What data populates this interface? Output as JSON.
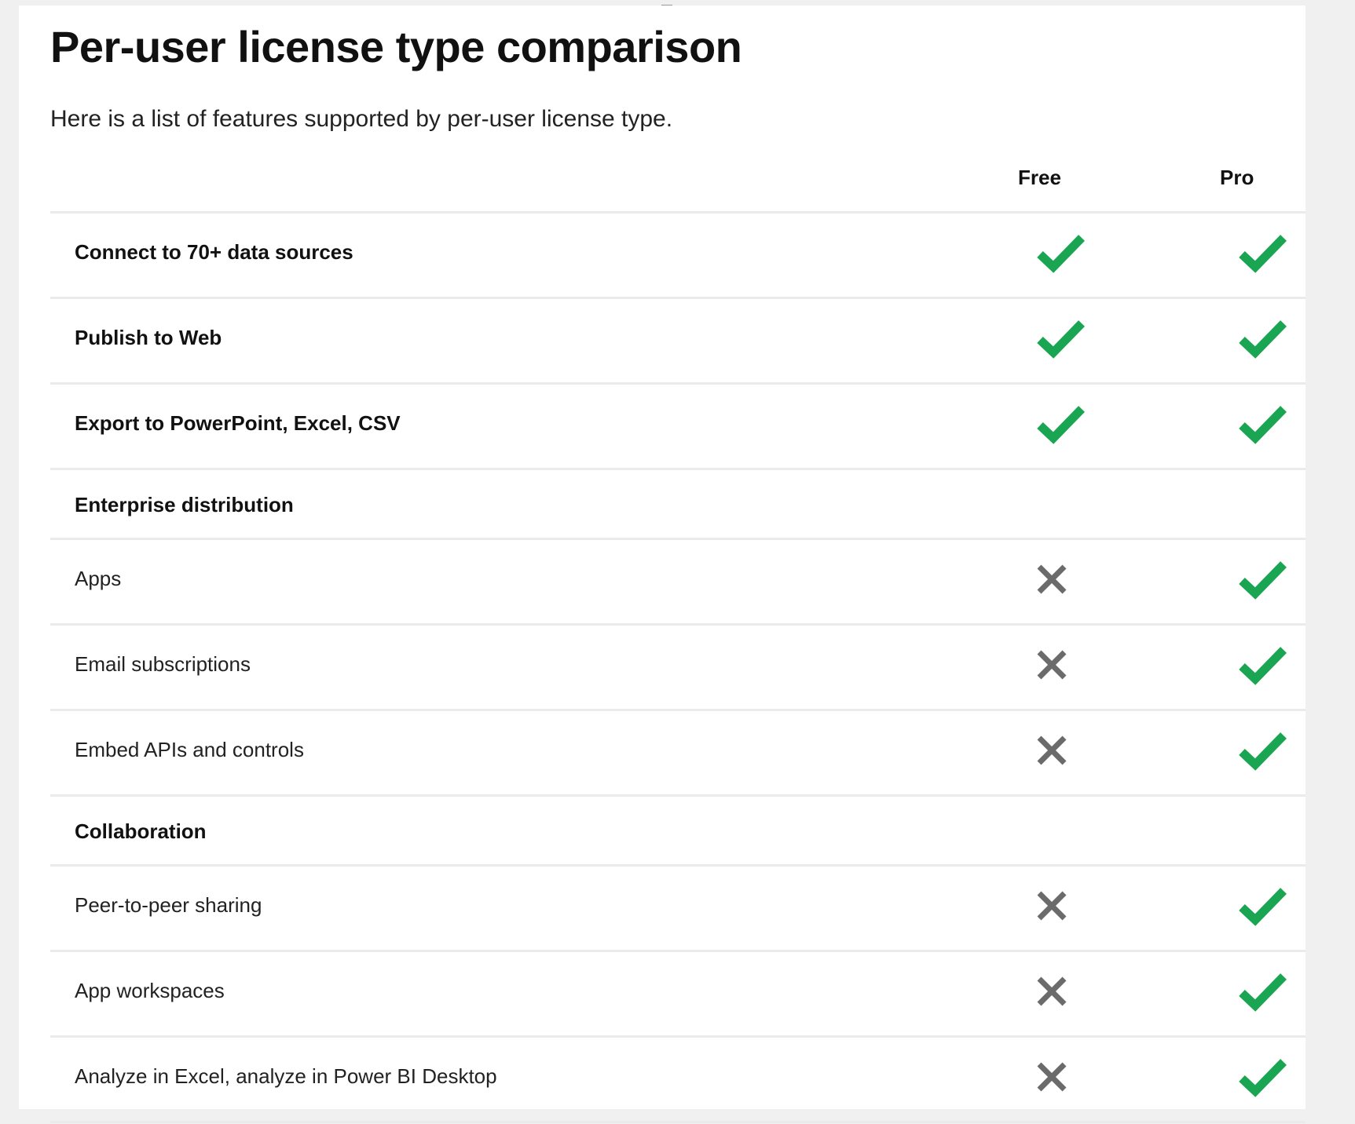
{
  "page": {
    "title": "Per-user license type comparison",
    "subtitle": "Here is a list of features supported by per-user license type."
  },
  "colors": {
    "check": "#1aa552",
    "cross": "#6b6b6b",
    "divider": "#ebebeb"
  },
  "table": {
    "columns": [
      "Free",
      "Pro"
    ],
    "rows": [
      {
        "label": "Connect to 70+ data sources",
        "kind": "feature-bold",
        "free": "check-icon",
        "pro": "check-icon"
      },
      {
        "label": "Publish to Web",
        "kind": "feature-bold",
        "free": "check-icon",
        "pro": "check-icon"
      },
      {
        "label": "Export to PowerPoint, Excel, CSV",
        "kind": "feature-bold",
        "free": "check-icon",
        "pro": "check-icon"
      },
      {
        "label": "Enterprise distribution",
        "kind": "section"
      },
      {
        "label": "Apps",
        "kind": "feature",
        "free": "cross-icon",
        "pro": "check-icon"
      },
      {
        "label": "Email subscriptions",
        "kind": "feature",
        "free": "cross-icon",
        "pro": "check-icon"
      },
      {
        "label": "Embed APIs and controls",
        "kind": "feature",
        "free": "cross-icon",
        "pro": "check-icon"
      },
      {
        "label": "Collaboration",
        "kind": "section"
      },
      {
        "label": "Peer-to-peer sharing",
        "kind": "feature",
        "free": "cross-icon",
        "pro": "check-icon"
      },
      {
        "label": "App workspaces",
        "kind": "feature",
        "free": "cross-icon",
        "pro": "check-icon"
      },
      {
        "label": "Analyze in Excel, analyze in Power BI Desktop",
        "kind": "feature",
        "free": "cross-icon",
        "pro": "check-icon"
      }
    ]
  }
}
